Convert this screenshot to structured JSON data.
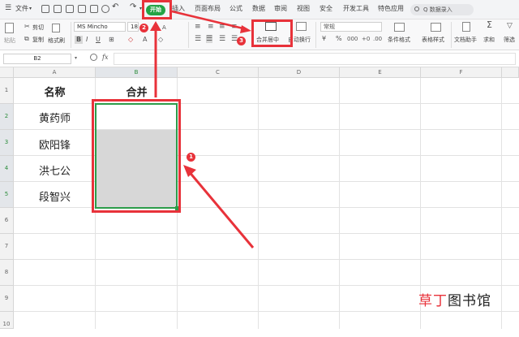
{
  "menubar": {
    "file_label": "文件",
    "start_tab": "开始",
    "tabs": [
      "插入",
      "页面布局",
      "公式",
      "数据",
      "审阅",
      "视图",
      "安全",
      "开发工具",
      "特色应用"
    ],
    "search_placeholder": "Q 数据录入"
  },
  "ribbon": {
    "paste": "粘贴",
    "cut": "剪切",
    "copy": "复制",
    "format_painter": "格式刷",
    "font_name": "MS Mincho",
    "font_size": "18",
    "merge_center": "合并居中",
    "wrap_text": "自动换行",
    "number_format": "常规",
    "conditional_format": "条件格式",
    "table_style": "表格样式",
    "doc_assistant": "文档助手",
    "sum": "求和",
    "filter": "筛选"
  },
  "formula_bar": {
    "name_box": "B2",
    "fx": "fx"
  },
  "sheet": {
    "columns": [
      "A",
      "B",
      "C",
      "D",
      "E",
      "F"
    ],
    "rows": [
      "1",
      "2",
      "3",
      "4",
      "5",
      "6",
      "7",
      "8",
      "9",
      "10"
    ],
    "header_a": "名称",
    "header_b": "合并",
    "names": [
      "黄药师",
      "欧阳锋",
      "洪七公",
      "段智兴"
    ]
  },
  "annotations": {
    "badges": [
      "1",
      "2",
      "3"
    ],
    "color": "#e8323a"
  },
  "watermark": {
    "accent": "草丁",
    "rest": "图书馆"
  }
}
